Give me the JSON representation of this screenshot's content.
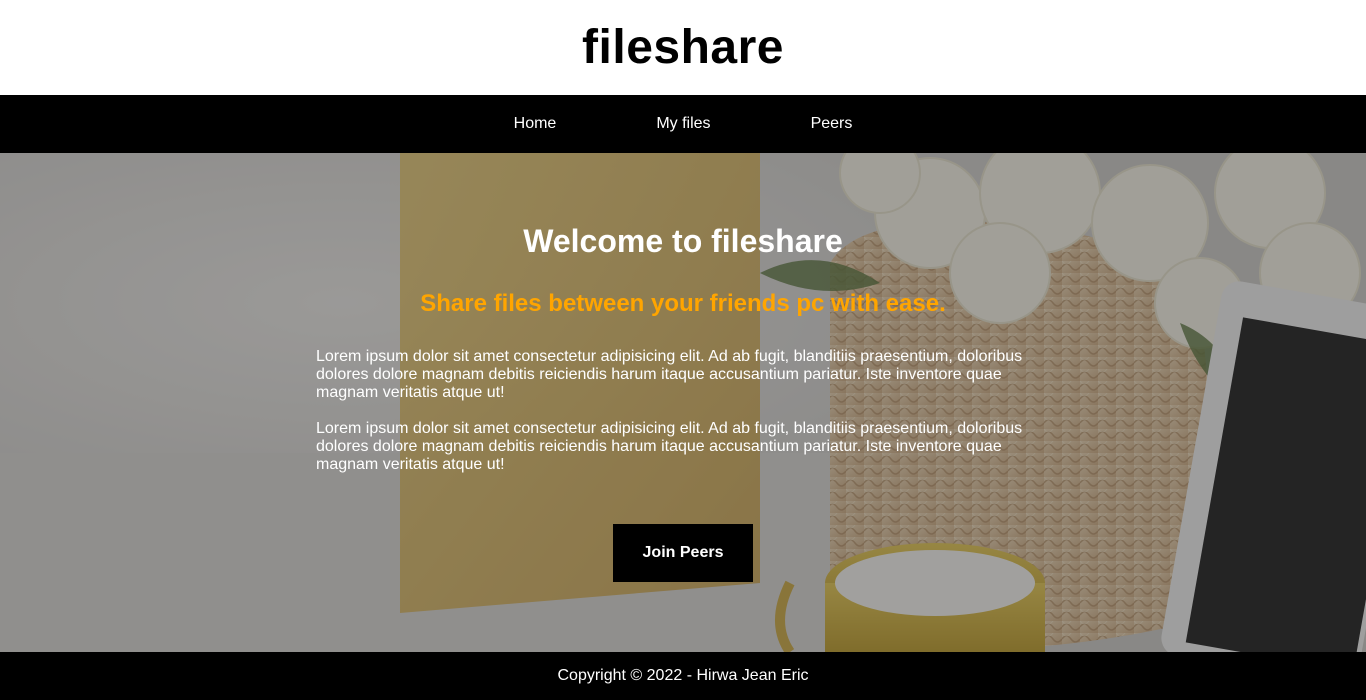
{
  "header": {
    "title": "fileshare"
  },
  "nav": {
    "items": [
      {
        "label": "Home"
      },
      {
        "label": "My files"
      },
      {
        "label": "Peers"
      }
    ]
  },
  "hero": {
    "title": "Welcome to fileshare",
    "subtitle": "Share files between your friends pc with ease.",
    "paragraphs": [
      "Lorem ipsum dolor sit amet consectetur adipisicing elit. Ad ab fugit, blanditiis praesentium, doloribus dolores dolore magnam debitis reiciendis harum itaque accusantium pariatur. Iste inventore quae magnam veritatis atque ut!",
      "Lorem ipsum dolor sit amet consectetur adipisicing elit. Ad ab fugit, blanditiis praesentium, doloribus dolores dolore magnam debitis reiciendis harum itaque accusantium pariatur. Iste inventore quae magnam veritatis atque ut!"
    ],
    "button_label": "Join Peers"
  },
  "footer": {
    "copyright": "Copyright © 2022 - Hirwa Jean Eric"
  },
  "colors": {
    "nav_bg": "#000000",
    "subtitle": "#ffa500",
    "button_bg": "#000000",
    "footer_bg": "#000000"
  }
}
